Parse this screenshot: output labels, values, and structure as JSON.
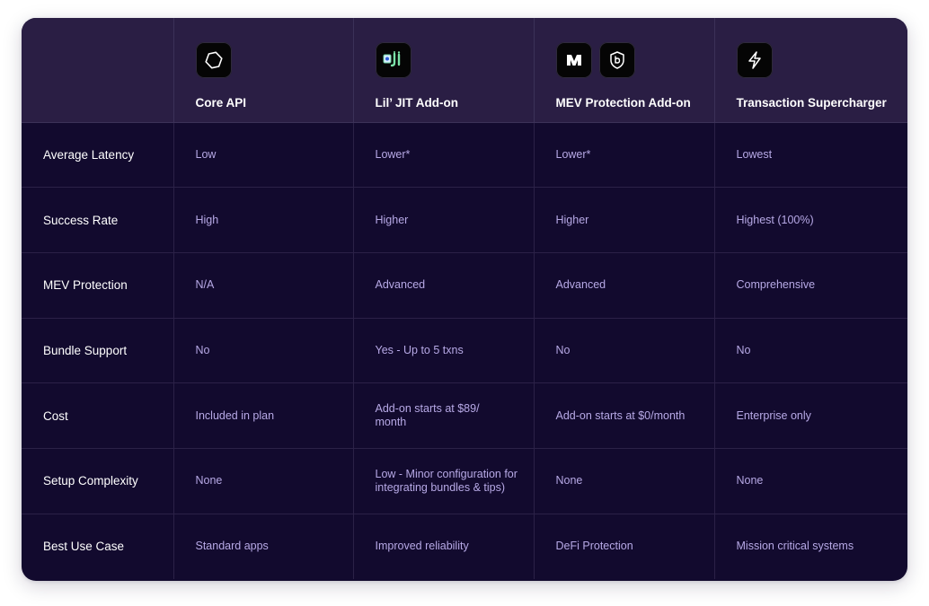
{
  "columns": [
    {
      "label": "",
      "icons": []
    },
    {
      "label": "Core API",
      "icons": [
        "hexagon-icon"
      ]
    },
    {
      "label": "Lil’ JIT Add-on",
      "icons": [
        "jit-logo-icon"
      ]
    },
    {
      "label": "MEV Protection Add-on",
      "icons": [
        "m-logo-icon",
        "shield-b-icon"
      ]
    },
    {
      "label": "Transaction Supercharger",
      "icons": [
        "lightning-icon"
      ]
    }
  ],
  "rows": [
    {
      "label": "Average Latency",
      "values": [
        "Low",
        "Lower*",
        "Lower*",
        "Lowest"
      ]
    },
    {
      "label": "Success Rate",
      "values": [
        "High",
        "Higher",
        "Higher",
        "Highest (100%)"
      ]
    },
    {
      "label": "MEV Protection",
      "values": [
        "N/A",
        "Advanced",
        "Advanced",
        "Comprehensive"
      ]
    },
    {
      "label": "Bundle Support",
      "values": [
        "No",
        "Yes - Up to 5 txns",
        "No",
        "No"
      ]
    },
    {
      "label": "Cost",
      "values": [
        "Included in plan",
        "Add-on starts at $89/ month",
        "Add-on starts at $0/month",
        "Enterprise only"
      ]
    },
    {
      "label": "Setup Complexity",
      "values": [
        "None",
        "Low - Minor configuration for integrating bundles & tips)",
        "None",
        "None"
      ]
    },
    {
      "label": "Best Use Case",
      "values": [
        "Standard apps",
        "Improved reliability",
        "DeFi Protection",
        "Mission critical systems"
      ]
    }
  ],
  "colors": {
    "card_background": "#120a2e",
    "header_background": "#2a1e44",
    "value_text": "#b7a9e6",
    "label_text": "#ffffff"
  }
}
